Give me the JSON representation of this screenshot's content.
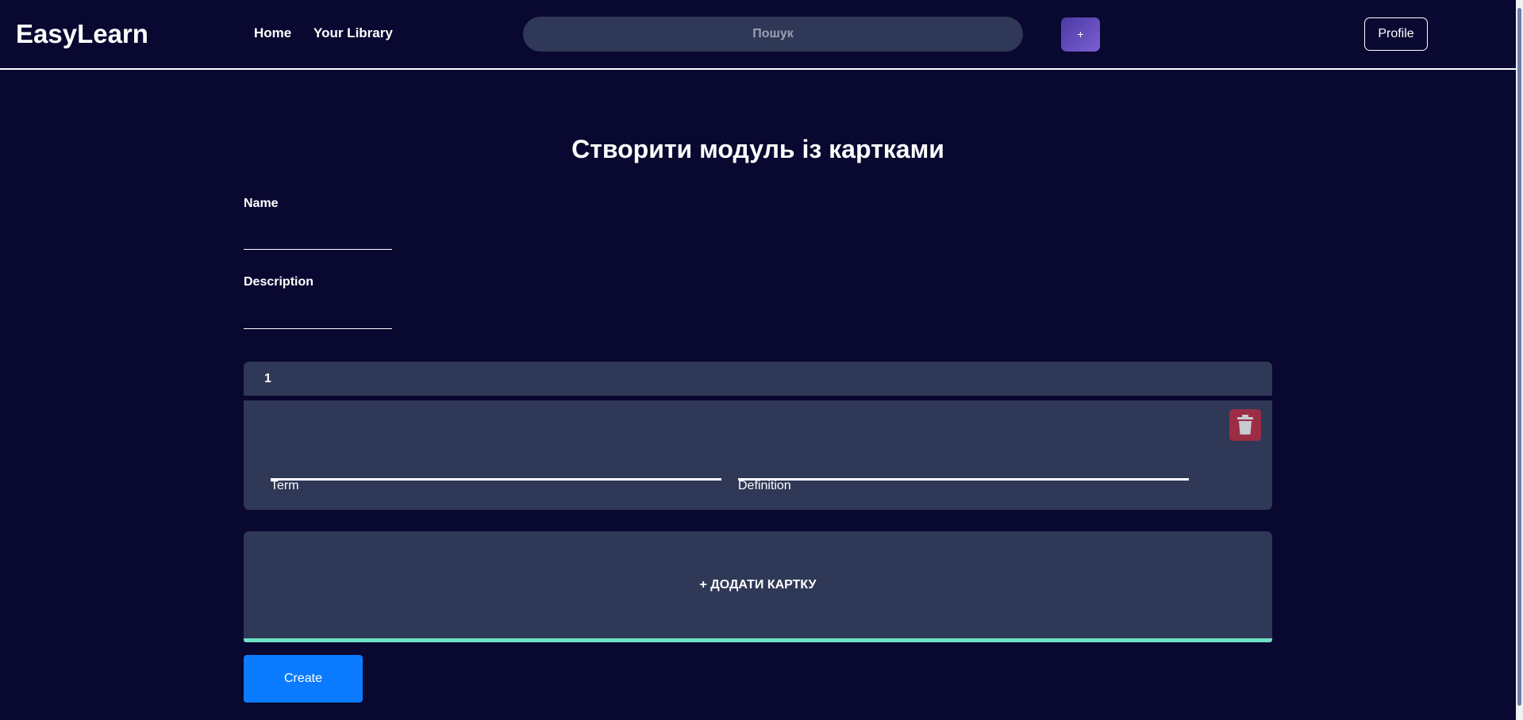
{
  "header": {
    "logo": "EasyLearn",
    "nav": {
      "home": "Home",
      "library": "Your Library"
    },
    "search": {
      "placeholder": "Пошук",
      "value": ""
    },
    "add_button_label": "+",
    "profile_label": "Profile"
  },
  "main": {
    "title": "Створити модуль із картками",
    "name_label": "Name",
    "name_value": "",
    "description_label": "Description",
    "description_value": "",
    "cards": [
      {
        "number": "1",
        "term_label": "Term",
        "term_value": "",
        "definition_label": "Definition",
        "definition_value": ""
      }
    ],
    "add_card_label": "+ ДОДАТИ КАРТКУ",
    "create_label": "Create"
  },
  "icons": {
    "delete": "trash-icon"
  },
  "colors": {
    "background": "#090830",
    "panel": "#2f3856",
    "accent_button": "#0a7bff",
    "delete_button": "#9b2e45",
    "add_card_border": "#6ee2c6",
    "plus_button_gradient_start": "#4b3ba5",
    "plus_button_gradient_end": "#7b5fd0"
  }
}
